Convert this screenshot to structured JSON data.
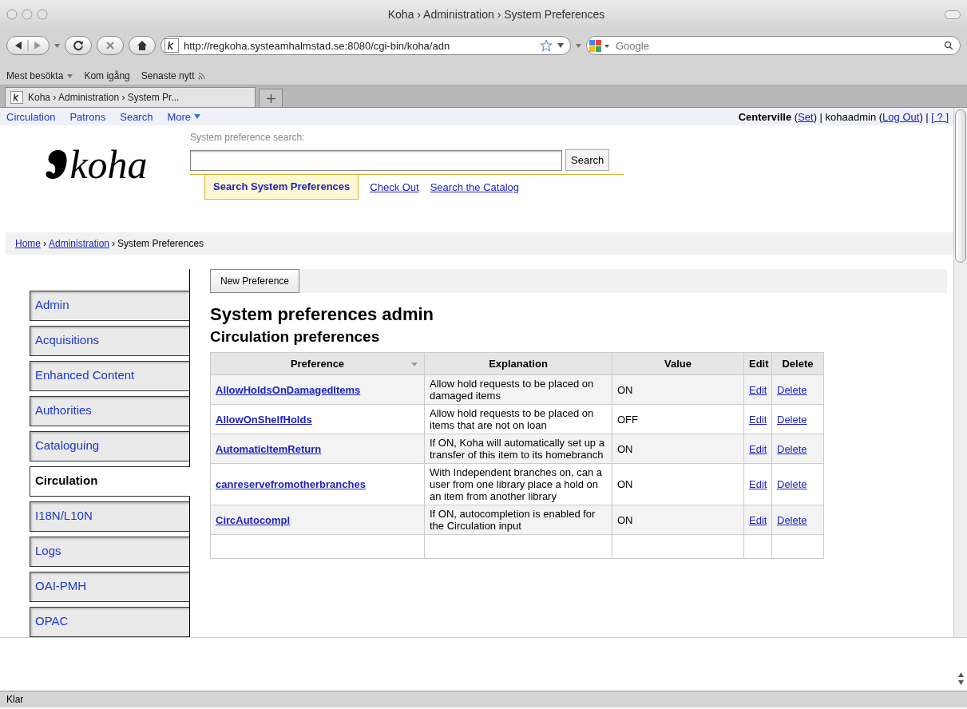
{
  "window": {
    "title": "Koha › Administration › System Preferences"
  },
  "toolbar": {
    "url": "http://regkoha.systeamhalmstad.se:8080/cgi-bin/koha/adn",
    "search_placeholder": "Google"
  },
  "bookmarks": [
    {
      "label": "Mest besökta",
      "kind": "menu"
    },
    {
      "label": "Kom igång",
      "kind": "link"
    },
    {
      "label": "Senaste nytt",
      "kind": "feed"
    }
  ],
  "tabs": [
    {
      "label": "Koha › Administration › System Pr...",
      "selected": true
    }
  ],
  "page": {
    "nav": [
      {
        "label": "Circulation",
        "menu": false
      },
      {
        "label": "Patrons",
        "menu": false
      },
      {
        "label": "Search",
        "menu": false
      },
      {
        "label": "More",
        "menu": true
      }
    ],
    "login": [
      {
        "text": "Centerville",
        "kind": "bold"
      },
      {
        "text": " (",
        "kind": "plain"
      },
      {
        "text": "Set",
        "kind": "link"
      },
      {
        "text": ") | kohaadmin (",
        "kind": "plain"
      },
      {
        "text": "Log Out",
        "kind": "link"
      },
      {
        "text": ") | ",
        "kind": "plain"
      },
      {
        "text": "[ ? ]",
        "kind": "link"
      }
    ],
    "logo": "koha",
    "search": {
      "label": "System preference search:",
      "button": "Search"
    },
    "search_tabs": [
      {
        "label": "Search System Preferences",
        "selected": true
      },
      {
        "label": "Check Out",
        "selected": false
      },
      {
        "label": "Search the Catalog",
        "selected": false
      }
    ],
    "breadcrumbs": {
      "separator": "›",
      "items": [
        {
          "label": "Home",
          "link": true
        },
        {
          "label": "Administration",
          "link": true
        },
        {
          "label": "System Preferences",
          "link": false
        }
      ]
    },
    "new_button": "New Preference",
    "heading": "System preferences admin",
    "subheading": "Circulation preferences",
    "sidebar": [
      {
        "label": "Admin",
        "selected": false
      },
      {
        "label": "Acquisitions",
        "selected": false
      },
      {
        "label": "Enhanced Content",
        "selected": false
      },
      {
        "label": "Authorities",
        "selected": false
      },
      {
        "label": "Cataloguing",
        "selected": false
      },
      {
        "label": "Circulation",
        "selected": true
      },
      {
        "label": "I18N/L10N",
        "selected": false
      },
      {
        "label": "Logs",
        "selected": false
      },
      {
        "label": "OAI-PMH",
        "selected": false
      },
      {
        "label": "OPAC",
        "selected": false
      }
    ],
    "table": {
      "columns": [
        {
          "label": "Preference",
          "sorted": true
        },
        {
          "label": "Explanation",
          "sorted": false
        },
        {
          "label": "Value",
          "sorted": false
        },
        {
          "label": "Edit",
          "sorted": false
        },
        {
          "label": "Delete",
          "sorted": false
        }
      ],
      "rows": [
        {
          "preference": "AllowHoldsOnDamagedItems",
          "explanation": "Allow hold requests to be placed on damaged items",
          "value": "ON",
          "edit": "Edit",
          "delete": "Delete"
        },
        {
          "preference": "AllowOnShelfHolds",
          "explanation": "Allow hold requests to be placed on items that are not on loan",
          "value": "OFF",
          "edit": "Edit",
          "delete": "Delete"
        },
        {
          "preference": "AutomaticItemReturn",
          "explanation": "If ON, Koha will automatically set up a transfer of this item to its homebranch",
          "value": "ON",
          "edit": "Edit",
          "delete": "Delete"
        },
        {
          "preference": "canreservefromotherbranches",
          "explanation": "With Independent branches on, can a user from one library place a hold on an item from another library",
          "value": "ON",
          "edit": "Edit",
          "delete": "Delete"
        },
        {
          "preference": "CircAutocompl",
          "explanation": "If ON, autocompletion is enabled for the Circulation input",
          "value": "ON",
          "edit": "Edit",
          "delete": "Delete"
        }
      ]
    }
  },
  "status_bar": "Klar"
}
